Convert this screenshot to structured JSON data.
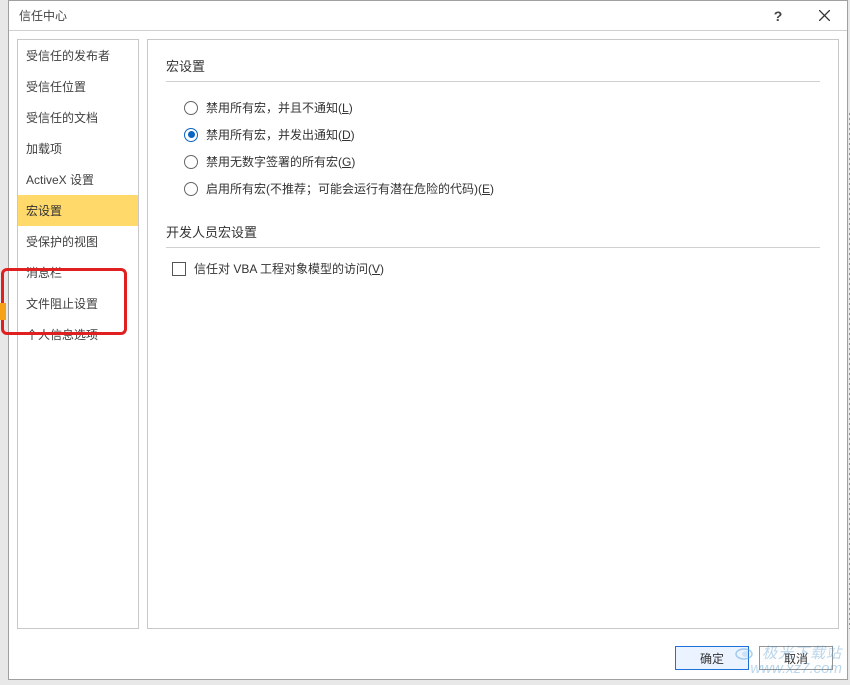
{
  "titlebar": {
    "title": "信任中心",
    "help_label": "?",
    "close_label": "×"
  },
  "sidebar": {
    "items": [
      {
        "label": "受信任的发布者"
      },
      {
        "label": "受信任位置"
      },
      {
        "label": "受信任的文档"
      },
      {
        "label": "加载项"
      },
      {
        "label": "ActiveX 设置"
      },
      {
        "label": "宏设置"
      },
      {
        "label": "受保护的视图"
      },
      {
        "label": "消息栏"
      },
      {
        "label": "文件阻止设置"
      },
      {
        "label": "个人信息选项"
      }
    ],
    "selected_index": 5
  },
  "content": {
    "section1_title": "宏设置",
    "macro_options": [
      {
        "text_pre": "禁用所有宏，并且不通知(",
        "hotkey": "L",
        "text_post": ")",
        "checked": false
      },
      {
        "text_pre": "禁用所有宏，并发出通知(",
        "hotkey": "D",
        "text_post": ")",
        "checked": true
      },
      {
        "text_pre": "禁用无数字签署的所有宏(",
        "hotkey": "G",
        "text_post": ")",
        "checked": false
      },
      {
        "text_pre": "启用所有宏(不推荐；可能会运行有潜在危险的代码)(",
        "hotkey": "E",
        "text_post": ")",
        "checked": false
      }
    ],
    "section2_title": "开发人员宏设置",
    "trust_vba": {
      "text_pre": "信任对 VBA 工程对象模型的访问(",
      "hotkey": "V",
      "text_post": ")",
      "checked": false
    }
  },
  "footer": {
    "ok_label": "确定",
    "cancel_label": "取消"
  },
  "watermark": {
    "line1": "极光下载站",
    "line2": "www.xz7.com"
  }
}
